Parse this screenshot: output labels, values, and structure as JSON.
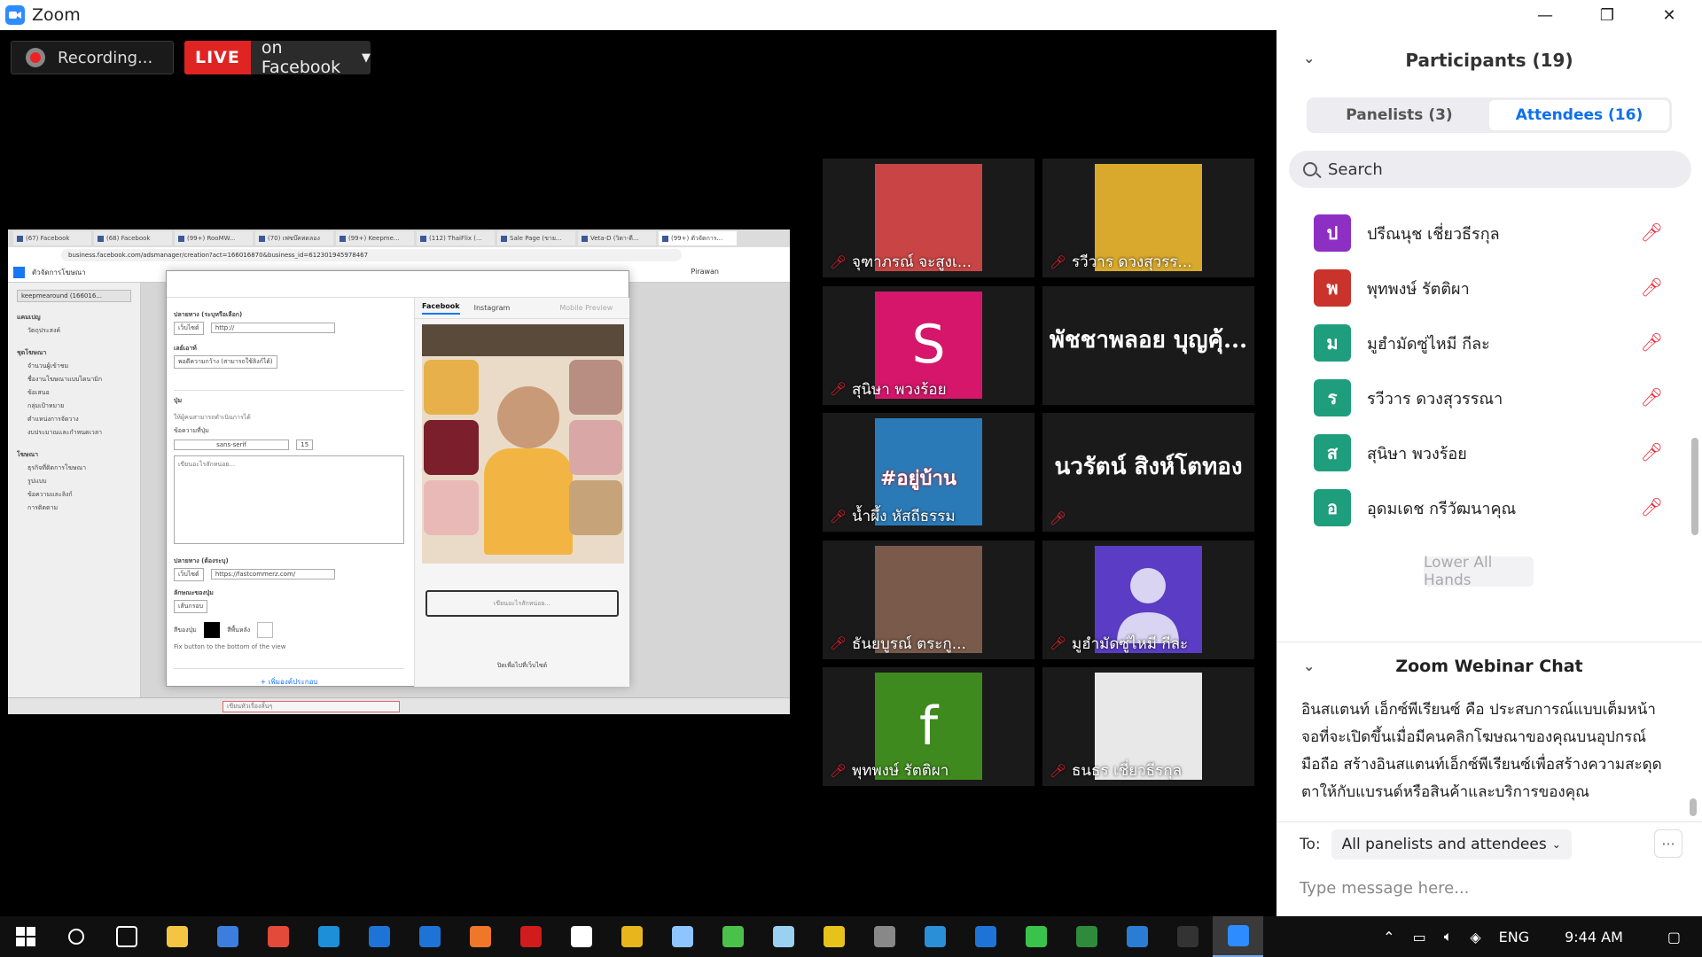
{
  "window": {
    "title": "Zoom",
    "min": "—",
    "max": "❐",
    "close": "✕"
  },
  "stage": {
    "recording_label": "Recording...",
    "live_badge": "LIVE",
    "live_target": "on Facebook",
    "live_caret": "▼"
  },
  "shared_screen": {
    "browser_tabs": [
      "(67) Facebook",
      "(68) Facebook",
      "(99+) RooMW...",
      "(70) เฟซบ๊คทดลอง",
      "(99+) Keepme...",
      "(112) ThaiFlix (...",
      "Sale Page (ขาย...",
      "Veta-D (วิตา-ดี...",
      "(99+) ตัวจัดการ..."
    ],
    "address": "business.facebook.com/adsmanager/creation?act=166016870&business_id=612301945978467",
    "fb_toolbar_title": "ตัวจัดการโฆษณา",
    "fb_user": "Pirawan",
    "account_select": "keepmearound (166016...",
    "left_items": [
      "แคมเปญ",
      "วัตถุประสงค์",
      "ชุดโฆษณา",
      "จำนวนผู้เข้าชม",
      "ชื่องานโฆษณาแบบไดนามิก",
      "ข้อเสนอ",
      "กลุ่มเป้าหมาย",
      "ตำแหน่งการจัดวาง",
      "งบประมาณและกำหนดเวลา",
      "โฆษณา",
      "ธุรกิจที่ติดการโฆษณา",
      "รูปแบบ",
      "ข้อความและลิงก์",
      "การติดตาม"
    ],
    "editor": {
      "dest_label": "ปลายทาง (ระบุหรือเลือก)",
      "dest_select": "เว็บไซต์",
      "dest_placeholder": "http://",
      "layout_label": "เลย์เอาท์",
      "layout_select": "พอดีความกว้าง (สามารถใช้ลิงก์ได้)",
      "section_button": "ปุ่ม",
      "button_hint": "ให้ผู้คนสามารถดำเนินการได้",
      "font_label": "ข้อความที่ปุ่ม",
      "font_select": "sans-serif",
      "font_size": "15",
      "text_placeholder": "เขียนอะไรสักหน่อย...",
      "dest2_label": "ปลายทาง (ต้องระบุ)",
      "dest2_select": "เว็บไซต์",
      "url_value": "https://fastcommerz.com/",
      "style_label": "ลักษณะของปุ่ม",
      "style_select": "เส้นกรอบ",
      "btncolor_label": "สีของปุ่ม",
      "bgcolor_label": "สีพื้นหลัง",
      "fix_label": "Fix button to the bottom of the view",
      "add_component": "+ เพิ่มองค์ประกอบ"
    },
    "preview_tabs": [
      "Facebook",
      "Instagram"
    ],
    "preview_mode": "Mobile Preview",
    "preview_box": "เขียนอะไรสักหน่อย...",
    "preview_footer": "ปิดเพื่อไปที่เว็บไซต์",
    "bottom_input": "เขียนหัวเรื่องลั้นๆ"
  },
  "video_tiles": [
    {
      "name": "จุฑาภรณ์  จะสูงเ...",
      "muted": true,
      "photo_color": "#c94545"
    },
    {
      "name": "รวีวาร ดวงสุวรร...",
      "muted": true,
      "photo_color": "#d8a92c"
    },
    {
      "name": "สุนิษา พวงร้อย",
      "muted": true,
      "letter": "S",
      "photo_color": "#d6166b"
    },
    {
      "big_name": "พัชชาพลอย บุญคุ้...",
      "muted": false
    },
    {
      "name": "น้ำผึ้ง หัสถีธรรม",
      "muted": true,
      "photo_color": "#2b7ab8",
      "photo_text": "#อยู่บ้าน"
    },
    {
      "big_name": "นวรัตน์ สิงห์โตทอง",
      "muted": true
    },
    {
      "name": "ธันยบูรณ์ ตระกู...",
      "muted": true,
      "photo_color": "#7a5a4a"
    },
    {
      "name": "มูฮำมัดซู่ไหมี กีละ",
      "muted": true,
      "photo_color": "#5b3cc4",
      "person_icon": true
    },
    {
      "name": "พุทพงษ์ รัตติผา",
      "muted": true,
      "letter": "f",
      "photo_color": "#3f8a1e"
    },
    {
      "name": "ธนธร เชี่ยวธีรกุล",
      "muted": true,
      "photo_color": "#e8e8e8"
    }
  ],
  "participants": {
    "title": "Participants (19)",
    "tabs": [
      "Panelists (3)",
      "Attendees (16)"
    ],
    "active_tab": 1,
    "search_placeholder": "Search",
    "list": [
      {
        "initial": "ป",
        "name": "ปรีณนุช เชี่ยวธีรกุล",
        "color": "#8e2fc4"
      },
      {
        "initial": "พ",
        "name": "พุทพงษ์ รัตติผา",
        "color": "#c9332b"
      },
      {
        "initial": "ม",
        "name": "มูฮำมัดซู่ไหมี กีละ",
        "color": "#1f9e7e"
      },
      {
        "initial": "ร",
        "name": "รวีวาร ดวงสุวรรณา",
        "color": "#1f9e7e"
      },
      {
        "initial": "ส",
        "name": "สุนิษา พวงร้อย",
        "color": "#1f9e7e"
      },
      {
        "initial": "อ",
        "name": "อุดมเดช กรีวัฒนาคุณ",
        "color": "#1f9e7e"
      }
    ],
    "lower_all_hands": "Lower All Hands"
  },
  "chat": {
    "title": "Zoom Webinar Chat",
    "message": "อินสแตนท์ เอ็กซ์พีเรียนซ์ คือ ประสบการณ์แบบเต็มหน้าจอที่จะเปิดขึ้นเมื่อมีคนคลิกโฆษณาของคุณบนอุปกรณ์มือถือ สร้างอินสแตนท์เอ็กซ์พีเรียนซ์เพื่อสร้างความสะดุดตาให้กับแบรนด์หรือสินค้าและบริการของคุณ",
    "to_label": "To:",
    "to_value": "All panelists and attendees",
    "more": "···",
    "input_placeholder": "Type message here..."
  },
  "taskbar": {
    "icons": [
      "windows-start-icon",
      "search-icon",
      "task-view-icon",
      "file-explorer-icon",
      "store-icon",
      "gift-icon",
      "remote-desktop-icon",
      "mail-icon",
      "edge-icon",
      "firefox-icon",
      "netflix-icon",
      "game-icon",
      "chrome-icon",
      "paint-icon",
      "wechat-icon",
      "notes-icon",
      "money-icon",
      "tank-icon",
      "network-icon",
      "onedrive-icon",
      "line-icon",
      "xbox-icon",
      "vscode-icon",
      "terminal-icon",
      "zoom-icon"
    ],
    "lang": "ENG",
    "time": "9:44 AM"
  },
  "colors": {
    "zoom_blue": "#2d8cff",
    "live_red": "#e02424",
    "mute_red": "#e22233",
    "active_tab": "#0e71eb"
  }
}
